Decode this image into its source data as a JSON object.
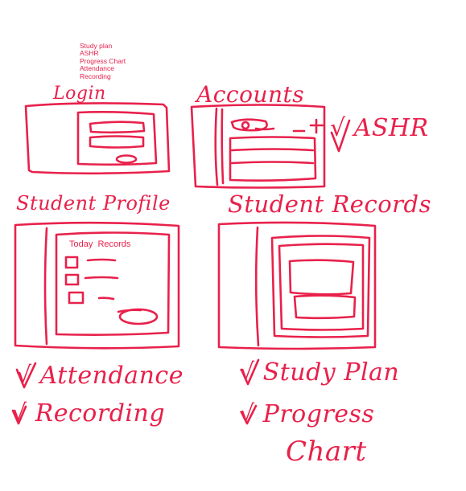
{
  "typed_list": [
    "Study plan",
    "ASHR",
    "Progress Chart",
    "Attendance",
    "Recording"
  ],
  "screens": {
    "login": {
      "title": "Login"
    },
    "accounts": {
      "title": "Accounts",
      "note": "√ ASHR"
    },
    "student_profile": {
      "title": "Student Profile",
      "panel_label": "Today  Records",
      "notes": [
        "√ Attendance",
        "√ Recording"
      ]
    },
    "student_records": {
      "title": "Student Records",
      "notes": [
        "√ Study Plan",
        "√ Progress",
        "Chart"
      ]
    }
  },
  "colors": {
    "ink": "#e8214b",
    "background": "#ffffff"
  }
}
